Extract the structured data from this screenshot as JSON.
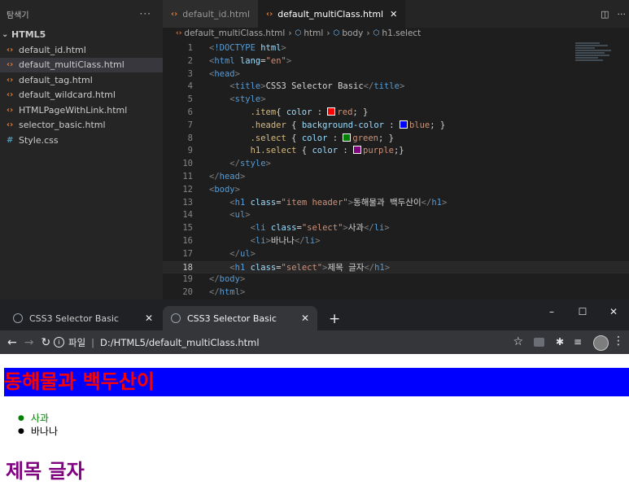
{
  "vscode": {
    "sidebar": {
      "title": "탐색기",
      "more": "···",
      "folder": "HTML5",
      "files": [
        {
          "name": "default_id.html",
          "type": "html"
        },
        {
          "name": "default_multiClass.html",
          "type": "html",
          "selected": true
        },
        {
          "name": "default_tag.html",
          "type": "html"
        },
        {
          "name": "default_wildcard.html",
          "type": "html"
        },
        {
          "name": "HTMLPageWithLink.html",
          "type": "html"
        },
        {
          "name": "selector_basic.html",
          "type": "html"
        },
        {
          "name": "Style.css",
          "type": "css"
        }
      ]
    },
    "tabs": [
      {
        "label": "default_id.html",
        "active": false
      },
      {
        "label": "default_multiClass.html",
        "active": true
      }
    ],
    "breadcrumb": [
      "default_multiClass.html",
      "html",
      "body",
      "h1.select"
    ],
    "current_line": 18,
    "swatches": {
      "red": "#ff0000",
      "blue": "#0000ff",
      "green": "#008000",
      "purple": "#800080"
    }
  },
  "code_lines": [
    "<!DOCTYPE html>",
    "<html lang=\"en\">",
    "<head>",
    "    <title>CSS3 Selector Basic</title>",
    "    <style>",
    "        .item{ color : red; }",
    "        .header { background-color : blue; }",
    "        .select { color : green; }",
    "        h1.select { color : purple;}",
    "    </style>",
    "</head>",
    "<body>",
    "    <h1 class=\"item header\">동해물과 백두산이</h1>",
    "    <ul>",
    "        <li class=\"select\">사과</li>",
    "        <li>바나나</li>",
    "    </ul>",
    "    <h1 class=\"select\">제목 글자</h1>",
    "</body>",
    "</html>"
  ],
  "chrome": {
    "tabs": [
      {
        "title": "CSS3 Selector Basic",
        "active": false
      },
      {
        "title": "CSS3 Selector Basic",
        "active": true
      }
    ],
    "new_tab": "+",
    "address": {
      "label": "파일",
      "path": "D:/HTML5/default_multiClass.html"
    },
    "window_controls": [
      "–",
      "☐",
      "✕"
    ]
  },
  "rendered_page": {
    "heading1": "동해물과 백두산이",
    "list": [
      "사과",
      "바나나"
    ],
    "heading2": "제목 글자"
  }
}
